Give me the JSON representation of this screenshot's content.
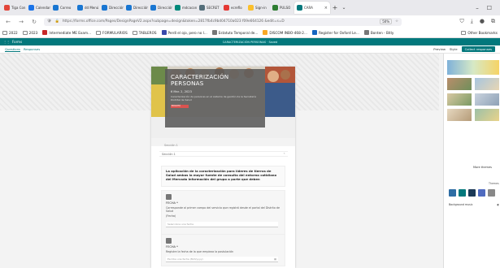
{
  "browser": {
    "tabs": [
      {
        "label": "Tiga Con",
        "color": "#e2453a"
      },
      {
        "label": "Calendar",
        "color": "#1a73e8"
      },
      {
        "label": "Correo",
        "color": "#1976d2"
      },
      {
        "label": "dd Menú",
        "color": "#1976d2"
      },
      {
        "label": "Dirección",
        "color": "#1976d2"
      },
      {
        "label": "Dirección",
        "color": "#1976d2"
      },
      {
        "label": "Dirección",
        "color": "#1976d2"
      },
      {
        "label": "mdcacon",
        "color": "#00897b"
      },
      {
        "label": "SECRET",
        "color": "#546e7a"
      },
      {
        "label": "ecreflo",
        "color": "#e53935"
      },
      {
        "label": "Sign-in",
        "color": "#fbc02d"
      },
      {
        "label": "PULSO",
        "color": "#2e7d32"
      }
    ],
    "active_tab": {
      "label": "CARA",
      "color": "#03787c"
    },
    "new_tab": "+",
    "url": "https://forms.office.com/Pages/DesignPageV2.aspx?subpage=design&token=2817fb4c9bd04710a023 f09e664126 &edit=s=D",
    "url_host": "office.com",
    "zoom": "50%",
    "bookmarks": [
      {
        "label": "2022",
        "kind": "folder"
      },
      {
        "label": "2023",
        "kind": "folder"
      },
      {
        "label": "Intermediate ME Exam...",
        "kind": "site",
        "color": "#c62828"
      },
      {
        "label": "FORMULARIOS",
        "kind": "folder"
      },
      {
        "label": "TABLEROS",
        "kind": "folder"
      },
      {
        "label": "Perdí el ojo, pero no l...",
        "kind": "site",
        "color": "#3949ab"
      },
      {
        "label": "Estatuto Temporal de...",
        "kind": "site",
        "color": "#777"
      },
      {
        "label": "DISCOM INBO-468-2...",
        "kind": "site",
        "color": "#f9a825"
      },
      {
        "label": "Register for Oxford Le...",
        "kind": "site",
        "color": "#1565c0"
      },
      {
        "label": "Bonten - Bitly",
        "kind": "site",
        "color": "#777"
      }
    ],
    "other_bookmarks": "Other Bookmarks"
  },
  "forms": {
    "app_name": "Forms",
    "header_center": "CARACTERIZACIÓN PERSONAS · Saved",
    "tabs": [
      "Questions",
      "Responses"
    ],
    "actions": {
      "preview": "Preview",
      "style": "Style",
      "collect": "Collect responses"
    }
  },
  "form": {
    "title": "CARACTERIZACIÓN PERSONAS",
    "date": "6 Mar. 2, 2023",
    "description": "Caracterización de personas en el sistema de gestión de la Secretaría Distrital de Salud",
    "logo_text": "BOGOTÁ",
    "section_label": "Sección 1",
    "section_name": "Sección 1",
    "intro": "La aplicación de la caracterización para líderes de tierras de Salud ambas la mayor fuente de consulta del entorno cotidiano del Mercado información del grupo a parte que deben",
    "questions": [
      {
        "label": "FECHA *",
        "text": "Corresponde al primer campo del servicio que registró desde el portal del Distrito de Salud",
        "sub": "(Fecha)",
        "answer": "Selecciona una fecha"
      },
      {
        "label": "FECHA *",
        "text": "Registre la fecha de la que empieza la postulación",
        "answer": "Escriba una fecha (M/d/yyyy)"
      }
    ]
  },
  "panel": {
    "more_themes": "More themes",
    "colors_label": "Themes",
    "swatches": [
      "#2e6da4",
      "#03787c",
      "#1b3a57",
      "#4f6bbf",
      "#888888"
    ],
    "background_music": "Background music"
  }
}
